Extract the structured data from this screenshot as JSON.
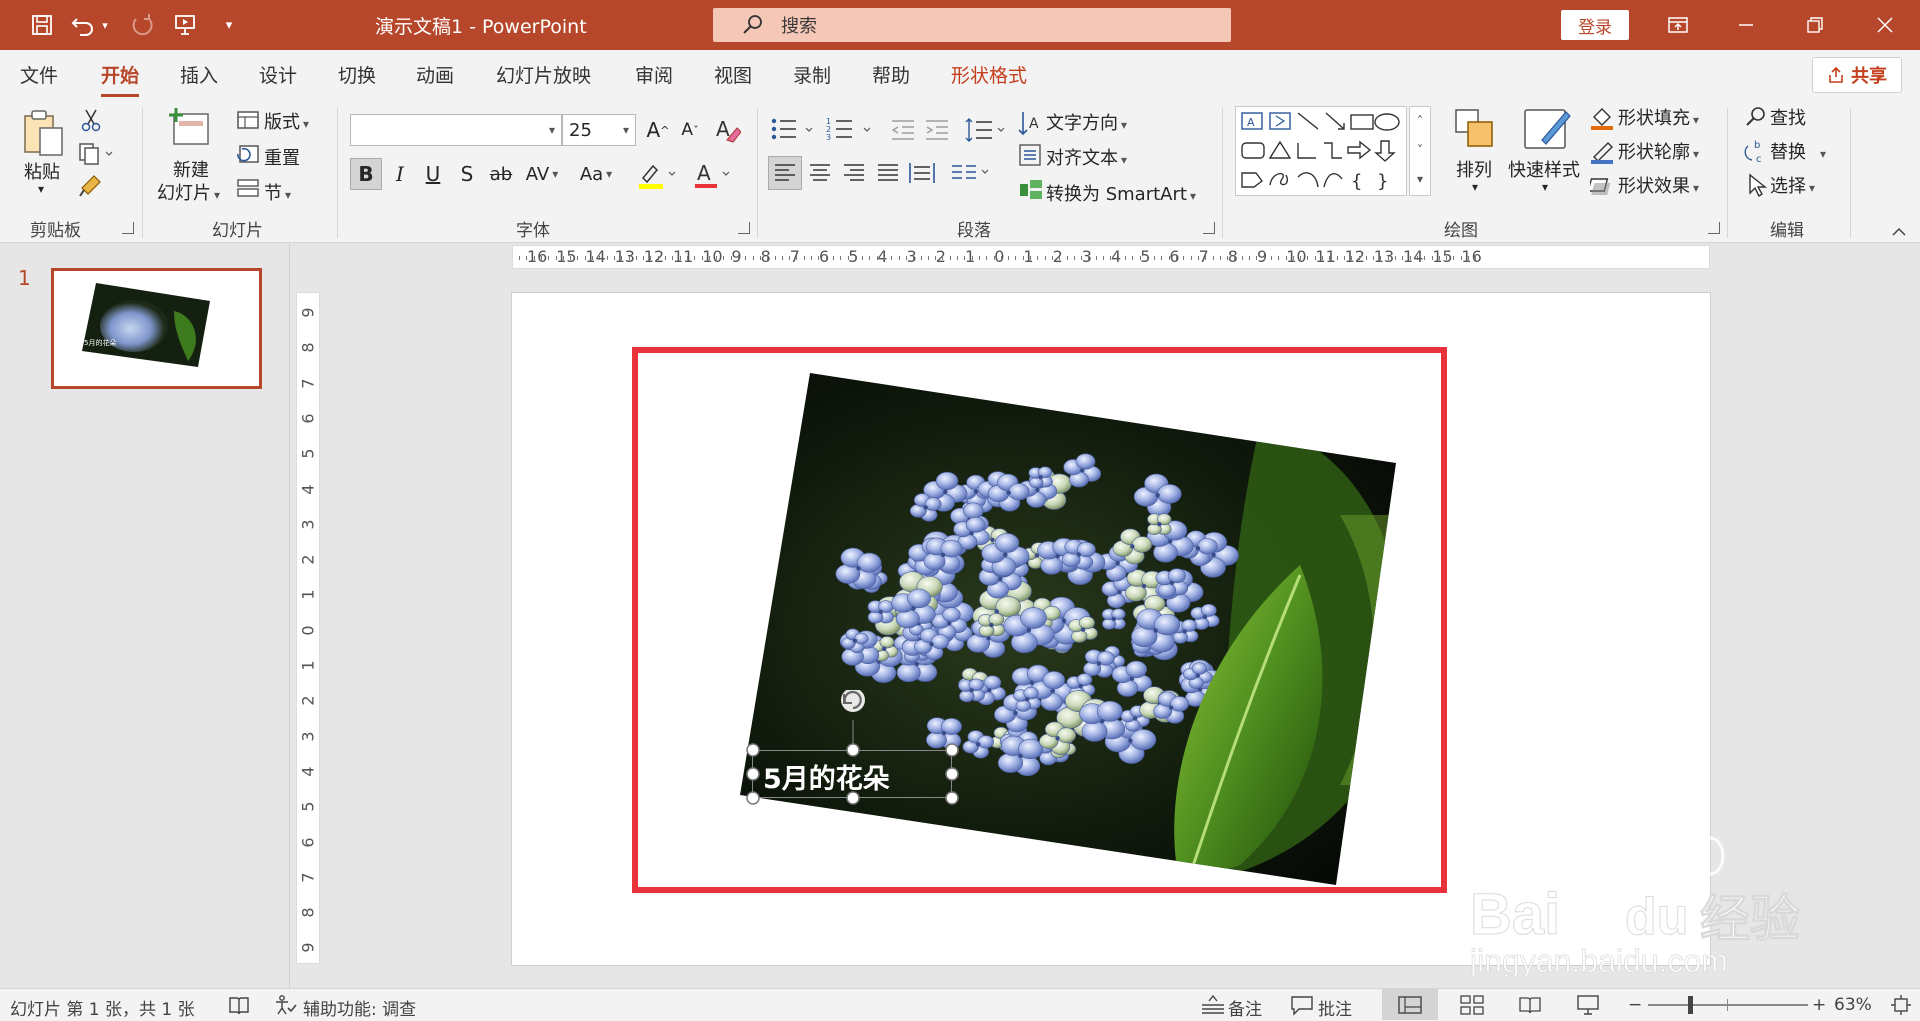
{
  "titlebar": {
    "doc_title": "演示文稿1  -  PowerPoint",
    "search_placeholder": "搜索",
    "login_label": "登录"
  },
  "tabs": [
    "文件",
    "开始",
    "插入",
    "设计",
    "切换",
    "动画",
    "幻灯片放映",
    "审阅",
    "视图",
    "录制",
    "帮助",
    "形状格式"
  ],
  "active_tab": "开始",
  "share_label": "共享",
  "ribbon": {
    "clipboard": {
      "paste": "粘贴",
      "group": "剪贴板"
    },
    "slides": {
      "new_slide_1": "新建",
      "new_slide_2": "幻灯片",
      "layout": "版式",
      "reset": "重置",
      "section": "节",
      "group": "幻灯片"
    },
    "font": {
      "font_name": "",
      "font_size": "25",
      "bold": "B",
      "italic": "I",
      "underline": "U",
      "strike": "S",
      "strikethrough": "ab",
      "spacing": "AV",
      "case": "Aa",
      "color": "A",
      "grow": "A",
      "shrink": "A",
      "group": "字体"
    },
    "paragraph": {
      "text_direction": "文字方向",
      "align_text": "对齐文本",
      "smartart": "转换为 SmartArt",
      "group": "段落"
    },
    "drawing": {
      "arrange": "排列",
      "quick_styles": "快速样式",
      "shape_fill": "形状填充",
      "shape_outline": "形状轮廓",
      "shape_effects": "形状效果",
      "group": "绘图"
    },
    "editing": {
      "find": "查找",
      "replace": "替换",
      "select": "选择",
      "group": "编辑"
    }
  },
  "thumbnail": {
    "slide_number": "1",
    "caption": "5月的花朵"
  },
  "slide": {
    "caption": "5月的花朵"
  },
  "ruler": {
    "h_labels": [
      "16",
      "15",
      "14",
      "13",
      "12",
      "11",
      "10",
      "9",
      "8",
      "7",
      "6",
      "5",
      "4",
      "3",
      "2",
      "1",
      "0",
      "1",
      "2",
      "3",
      "4",
      "5",
      "6",
      "7",
      "8",
      "9",
      "10",
      "11",
      "12",
      "13",
      "14",
      "15",
      "16"
    ],
    "v_labels": [
      "9",
      "8",
      "7",
      "6",
      "5",
      "4",
      "3",
      "2",
      "1",
      "0",
      "1",
      "2",
      "3",
      "4",
      "5",
      "6",
      "7",
      "8",
      "9"
    ]
  },
  "statusbar": {
    "slide_info": "幻灯片 第 1 张，共 1 张",
    "accessibility": "辅助功能: 调查",
    "notes": "备注",
    "comments": "批注",
    "zoom": "63%"
  },
  "colors": {
    "brand": "#b7472a",
    "frame": "#e8333a",
    "contextual_tab": "#c43e1c"
  }
}
